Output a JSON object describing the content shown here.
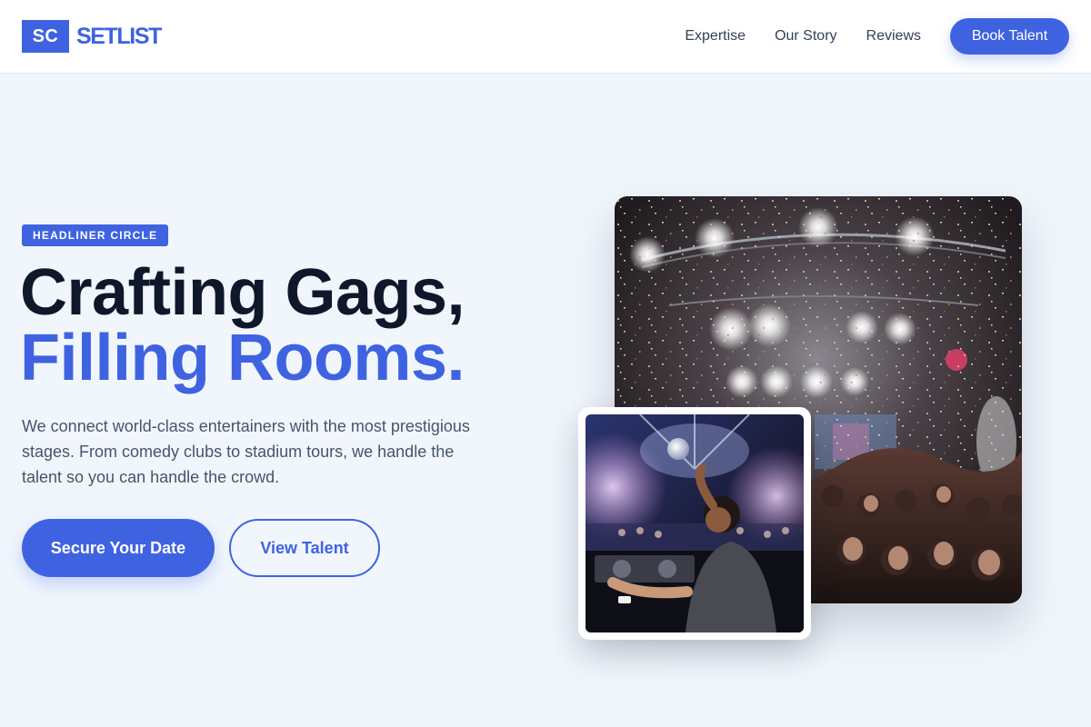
{
  "brand": {
    "mark": "SC",
    "name": "SETLIST",
    "accent": "#3f63e0"
  },
  "nav": {
    "links": [
      "Expertise",
      "Our Story",
      "Reviews"
    ],
    "cta": "Book Talent"
  },
  "hero": {
    "badge": "HEADLINER CIRCLE",
    "headline_line1": "Crafting Gags,",
    "headline_line2": "Filling Rooms.",
    "lead": "We connect world-class entertainers with the most prestigious stages. From comedy clubs to stadium tours, we handle the talent so you can handle the crowd.",
    "primary_cta": "Secure Your Date",
    "secondary_cta": "View Talent"
  },
  "images": {
    "main": "concert-crowd-confetti-photo",
    "small": "dj-performing-nightclub-photo"
  }
}
